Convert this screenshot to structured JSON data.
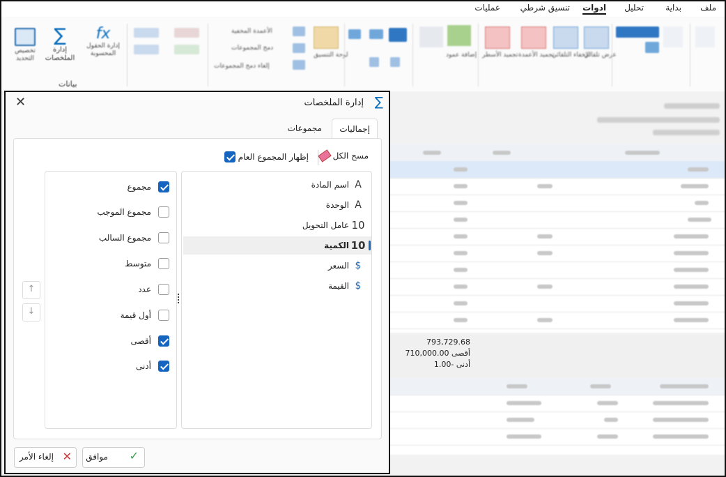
{
  "menu": {
    "tabs": [
      "ملف",
      "بداية",
      "ادوات",
      "تحليل",
      "تنسيق شرطي",
      "عمليات"
    ],
    "active": "ادوات"
  },
  "ribbon": {
    "group_data_label": "بيانات",
    "btn_summaries": "إدارة الملخصات",
    "btn_calc_field": "إدارة الحقول المحسوبة",
    "btn_custom": "تخصيص التحديد",
    "show_ovbs_label": "الأعمدة المخفية",
    "merge_groups_label": "دمج المجموعات",
    "unmerge_groups_label": "إلغاء دمج المجموعات",
    "show_layout_label": "لوحة التنسيق",
    "add_column_label": "إضافة عمود",
    "freeze_cols_label": "تجميد الأعمدة",
    "freeze_rows_label": "تجميد الأسطر",
    "group_by_label": "الإخفاء التلقائي",
    "auto_width_label": "عرض تلقائي"
  },
  "background": {
    "stats": [
      "793,729.68",
      "710,000.00 أقصى",
      "1.00- أدنى"
    ]
  },
  "dialog": {
    "title": "إدارة الملخصات",
    "tabs": [
      "إجماليات",
      "مجموعات"
    ],
    "active_tab": "إجماليات",
    "toolbar": {
      "clear_all": "مسح الكل",
      "show_grand_total": "إظهار المجموع العام",
      "show_grand_total_checked": true
    },
    "fields": [
      {
        "label": "اسم المادة",
        "icon": "text-field-icon",
        "glyph": "A"
      },
      {
        "label": "الوحدة",
        "icon": "text-field-icon",
        "glyph": "A"
      },
      {
        "label": "عامل التحويل",
        "icon": "number-field-icon",
        "glyph": "10"
      },
      {
        "label": "الكمية",
        "icon": "number-field-icon",
        "glyph": "10",
        "selected": true
      },
      {
        "label": "السعر",
        "icon": "currency-field-icon",
        "glyph": "$"
      },
      {
        "label": "القيمة",
        "icon": "currency-field-icon",
        "glyph": "$"
      }
    ],
    "aggregates": [
      {
        "label": "مجموع",
        "checked": true
      },
      {
        "label": "مجموع الموجب",
        "checked": false
      },
      {
        "label": "مجموع السالب",
        "checked": false
      },
      {
        "label": "متوسط",
        "checked": false
      },
      {
        "label": "عدد",
        "checked": false
      },
      {
        "label": "أول قيمة",
        "checked": false
      },
      {
        "label": "أقصى",
        "checked": true
      },
      {
        "label": "أدنى",
        "checked": true
      }
    ],
    "ok_label": "موافق",
    "cancel_label": "إلغاء الأمر"
  }
}
